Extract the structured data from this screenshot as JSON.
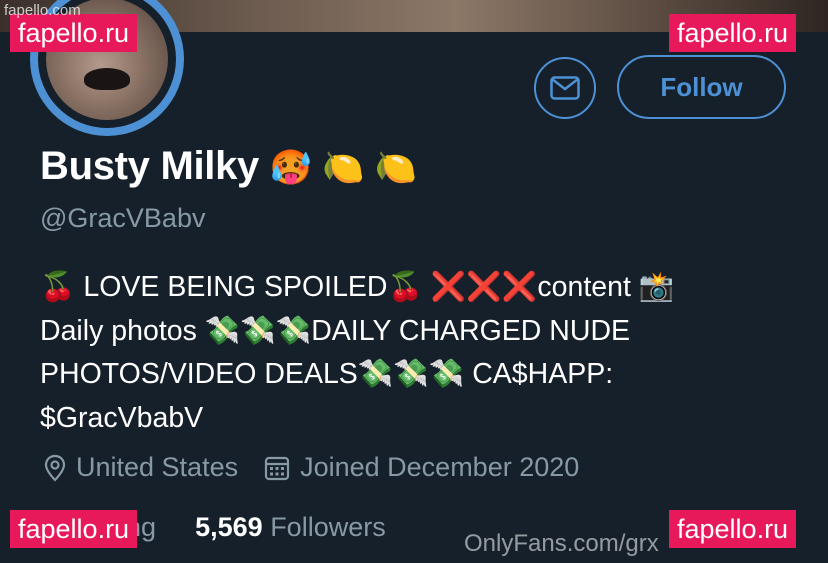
{
  "profile": {
    "display_name": "Busty Milky",
    "name_emojis": "🥵 🍋 🍋",
    "handle": "@GracVBabv",
    "bio": {
      "line1_a": "🍒 LOVE BEING SPOILED🍒 ",
      "line1_x": "❌❌❌",
      "line1_b": "content 📸",
      "line2": "Daily photos 💸💸💸DAILY CHARGED NUDE",
      "line3": "PHOTOS/VIDEO DEALS💸💸💸 CA$HAPP:",
      "line4": "$GracVbabV"
    },
    "location": "United States",
    "joined": "Joined December 2020",
    "following_label": "Following",
    "followers_count": "5,569",
    "followers_label": "Followers"
  },
  "actions": {
    "follow_label": "Follow",
    "message_icon": "mail-icon"
  },
  "watermarks": {
    "top_left_small": "fapello.com",
    "corner_label": "fapello.ru",
    "onlyfans": "OnlyFans.com/grx"
  },
  "colors": {
    "background": "#15202b",
    "accent": "#4d91d4",
    "muted": "#8899a6",
    "watermark": "#e8195a"
  }
}
